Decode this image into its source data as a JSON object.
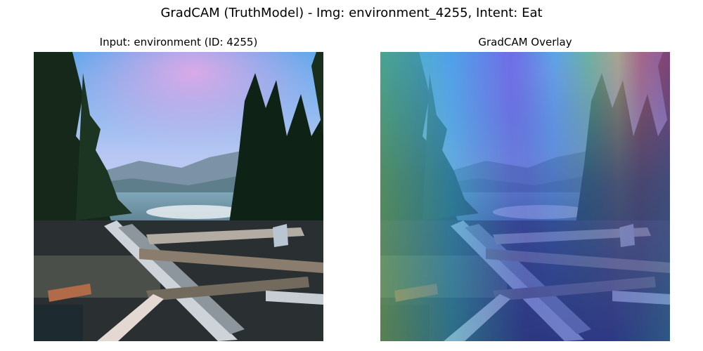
{
  "figure": {
    "suptitle": "GradCAM (TruthModel) - Img: environment_4255, Intent: Eat"
  },
  "panels": [
    {
      "title": "Input: environment (ID: 4255)",
      "content": "landscape photo: pine trees, lake, mountains, driftwood logs"
    },
    {
      "title": "GradCAM Overlay",
      "content": "same photo with jet colormap heatmap overlay"
    }
  ],
  "colors": {
    "sky_top": "#4aa0e6",
    "sky_pink": "#d9a6e8",
    "tree_dark": "#0f1f14",
    "water": "#6c9fb4",
    "log_light": "#c9ced3",
    "heat_hot": "#e83a3a",
    "heat_cool": "#2a2aa8"
  }
}
